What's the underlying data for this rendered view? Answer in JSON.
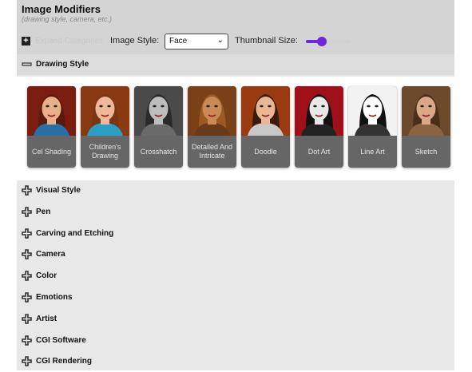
{
  "header": {
    "title": "Image Modifiers",
    "subtitle": "(drawing style, camera, etc.)"
  },
  "toolbar": {
    "expand_label": "Expand Categories",
    "image_style_label": "Image Style:",
    "image_style_value": "Face",
    "thumbnail_label": "Thumbnail Size:",
    "thumbnail_level": 0.35
  },
  "open_section": {
    "label": "Drawing Style",
    "items": [
      {
        "label": "Cel Shading",
        "bg": "#7a1d0f",
        "skin": "#e8b08a",
        "hair": "#5a1a0c",
        "shirt": "#2a6fa8"
      },
      {
        "label": "Children's Drawing",
        "bg": "#8a3a12",
        "skin": "#f0b896",
        "hair": "#7a3514",
        "shirt": "#2aa0c8"
      },
      {
        "label": "Crosshatch",
        "bg": "#4a4a4a",
        "skin": "#bdbdbd",
        "hair": "#2a2a2a",
        "shirt": "#6a6a6a"
      },
      {
        "label": "Detailed And Intricate",
        "bg": "#7a4018",
        "skin": "#c98a55",
        "hair": "#9a5a22",
        "shirt": "#6a3a18"
      },
      {
        "label": "Doodle",
        "bg": "#9a3a10",
        "skin": "#e8b892",
        "hair": "#3a1a0a",
        "shirt": "#c8c8c8"
      },
      {
        "label": "Dot Art",
        "bg": "#a0101a",
        "skin": "#e8e8e8",
        "hair": "#111111",
        "shirt": "#222222"
      },
      {
        "label": "Line Art",
        "bg": "#f2f2f2",
        "skin": "#ffffff",
        "hair": "#111111",
        "shirt": "#333333"
      },
      {
        "label": "Sketch",
        "bg": "#6a4a2a",
        "skin": "#d8a888",
        "hair": "#4a2e1a",
        "shirt": "#8a6440"
      }
    ]
  },
  "sections": [
    "Visual Style",
    "Pen",
    "Carving and Etching",
    "Camera",
    "Color",
    "Emotions",
    "Artist",
    "CGI Software",
    "CGI Rendering"
  ]
}
